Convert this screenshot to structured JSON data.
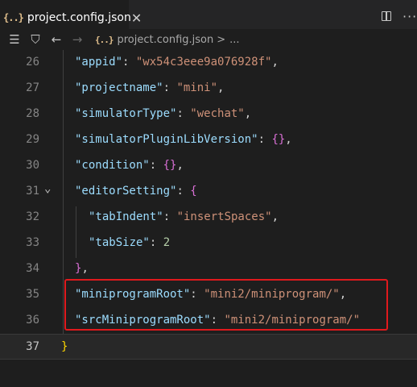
{
  "tab": {
    "icon": "json-braces-icon",
    "icon_text": "{..}",
    "label": "project.config.json"
  },
  "breadcrumb": {
    "icon_text": "{..}",
    "file": "project.config.json",
    "sep": ">",
    "more": "..."
  },
  "lines": [
    {
      "num": "26",
      "tokens": [
        {
          "t": "\"appid\"",
          "c": "k"
        },
        {
          "t": ": ",
          "c": "p"
        },
        {
          "t": "\"wx54c3eee9a076928f\"",
          "c": "s"
        },
        {
          "t": ",",
          "c": "p"
        }
      ]
    },
    {
      "num": "27",
      "tokens": [
        {
          "t": "\"projectname\"",
          "c": "k"
        },
        {
          "t": ": ",
          "c": "p"
        },
        {
          "t": "\"mini\"",
          "c": "s"
        },
        {
          "t": ",",
          "c": "p"
        }
      ]
    },
    {
      "num": "28",
      "tokens": [
        {
          "t": "\"simulatorType\"",
          "c": "k"
        },
        {
          "t": ": ",
          "c": "p"
        },
        {
          "t": "\"wechat\"",
          "c": "s"
        },
        {
          "t": ",",
          "c": "p"
        }
      ]
    },
    {
      "num": "29",
      "tokens": [
        {
          "t": "\"simulatorPluginLibVersion\"",
          "c": "k"
        },
        {
          "t": ": ",
          "c": "p"
        },
        {
          "t": "{}",
          "c": "b1"
        },
        {
          "t": ",",
          "c": "p"
        }
      ]
    },
    {
      "num": "30",
      "tokens": [
        {
          "t": "\"condition\"",
          "c": "k"
        },
        {
          "t": ": ",
          "c": "p"
        },
        {
          "t": "{}",
          "c": "b1"
        },
        {
          "t": ",",
          "c": "p"
        }
      ]
    },
    {
      "num": "31",
      "tokens": [
        {
          "t": "\"editorSetting\"",
          "c": "k"
        },
        {
          "t": ": ",
          "c": "p"
        },
        {
          "t": "{",
          "c": "b1"
        }
      ]
    },
    {
      "num": "32",
      "tokens": [
        {
          "t": "\"tabIndent\"",
          "c": "k"
        },
        {
          "t": ": ",
          "c": "p"
        },
        {
          "t": "\"insertSpaces\"",
          "c": "s"
        },
        {
          "t": ",",
          "c": "p"
        }
      ]
    },
    {
      "num": "33",
      "tokens": [
        {
          "t": "\"tabSize\"",
          "c": "k"
        },
        {
          "t": ": ",
          "c": "p"
        },
        {
          "t": "2",
          "c": "n"
        }
      ]
    },
    {
      "num": "34",
      "tokens": [
        {
          "t": "}",
          "c": "b1"
        },
        {
          "t": ",",
          "c": "p"
        }
      ]
    },
    {
      "num": "35",
      "tokens": [
        {
          "t": "\"miniprogramRoot\"",
          "c": "k"
        },
        {
          "t": ": ",
          "c": "p"
        },
        {
          "t": "\"mini2/miniprogram/\"",
          "c": "s"
        },
        {
          "t": ",",
          "c": "p"
        }
      ]
    },
    {
      "num": "36",
      "tokens": [
        {
          "t": "\"srcMiniprogramRoot\"",
          "c": "k"
        },
        {
          "t": ": ",
          "c": "p"
        },
        {
          "t": "\"mini2/miniprogram/\"",
          "c": "s"
        }
      ]
    },
    {
      "num": "37",
      "tokens": [
        {
          "t": "}",
          "c": "b0"
        }
      ]
    }
  ],
  "current_line": "37",
  "highlighted_lines": [
    "35",
    "36"
  ],
  "colors": {
    "highlight_border": "#e0191d",
    "string": "#ce9178",
    "key": "#9cdcfe"
  }
}
